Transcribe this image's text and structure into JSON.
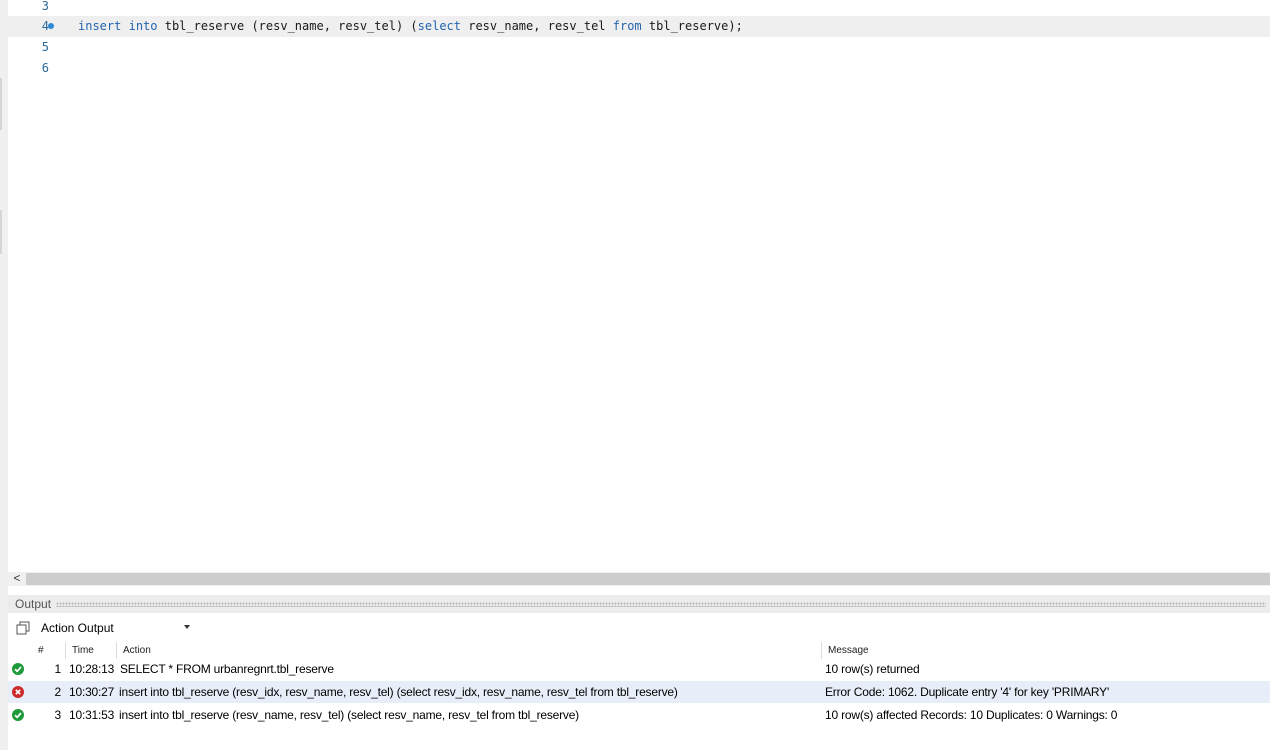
{
  "editor": {
    "lines": [
      {
        "number": "3",
        "text": ""
      },
      {
        "number": "4",
        "text": "insert into tbl_reserve (resv_name, resv_tel) (select resv_name, resv_tel from tbl_reserve);",
        "current": true
      },
      {
        "number": "5",
        "text": ""
      },
      {
        "number": "6",
        "text": ""
      }
    ],
    "keywords": [
      "insert",
      "into",
      "select",
      "from"
    ],
    "keyword_color": "#2365b0"
  },
  "hscroll": {
    "arrow": "<"
  },
  "output": {
    "title": "Output",
    "dropdown_value": "Action Output",
    "columns": {
      "num": "#",
      "time": "Time",
      "action": "Action",
      "message": "Message"
    },
    "rows": [
      {
        "status": "ok",
        "num": "1",
        "time": "10:28:13",
        "action": "SELECT * FROM urbanregnrt.tbl_reserve",
        "message": "10 row(s) returned"
      },
      {
        "status": "error",
        "num": "2",
        "time": "10:30:27",
        "action": "insert into tbl_reserve (resv_idx, resv_name, resv_tel) (select resv_idx, resv_name, resv_tel from tbl_reserve)",
        "message": "Error Code: 1062. Duplicate entry '4' for key 'PRIMARY'"
      },
      {
        "status": "ok",
        "num": "3",
        "time": "10:31:53",
        "action": "insert into tbl_reserve (resv_name, resv_tel) (select resv_name, resv_tel from tbl_reserve)",
        "message": "10 row(s) affected Records: 10  Duplicates: 0  Warnings: 0"
      }
    ],
    "status_colors": {
      "ok": "#1e9a3a",
      "error": "#cc2a2a"
    }
  }
}
